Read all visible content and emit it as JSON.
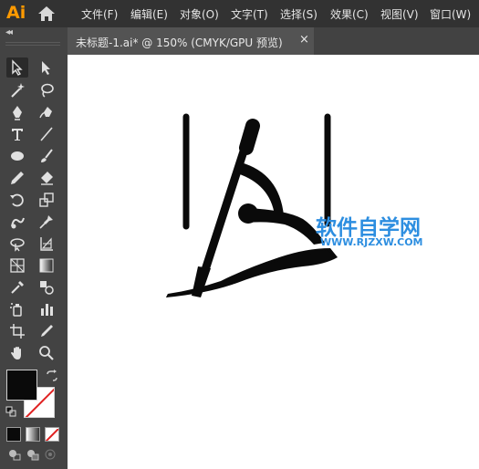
{
  "app": {
    "logo": "Ai"
  },
  "menu": {
    "items": [
      "文件(F)",
      "编辑(E)",
      "对象(O)",
      "文字(T)",
      "选择(S)",
      "效果(C)",
      "视图(V)",
      "窗口(W)"
    ]
  },
  "tools": {
    "collapse_glyph": "◂◂",
    "icons": [
      "selection-tool-icon",
      "direct-selection-tool-icon",
      "magic-wand-tool-icon",
      "lasso-tool-icon",
      "pen-tool-icon",
      "curvature-tool-icon",
      "type-tool-icon",
      "line-segment-tool-icon",
      "ellipse-tool-icon",
      "paintbrush-tool-icon",
      "pencil-tool-icon",
      "eraser-tool-icon",
      "rotate-tool-icon",
      "scale-tool-icon",
      "warp-tool-icon",
      "puppet-warp-tool-icon",
      "free-transform-tool-icon",
      "shape-builder-tool-icon",
      "perspective-grid-tool-icon",
      "gradient-tool-icon",
      "eyedropper-tool-icon",
      "blend-tool-icon",
      "symbol-sprayer-tool-icon",
      "column-graph-tool-icon",
      "artboard-tool-icon",
      "slice-tool-icon",
      "hand-tool-icon",
      "zoom-tool-icon"
    ]
  },
  "document": {
    "tab_title": "未标题-1.ai* @ 150% (CMYK/GPU 预览)",
    "close_glyph": "×"
  },
  "watermark": {
    "name": "软件自学网",
    "url": "WWW.RJZXW.COM"
  },
  "colors": {
    "fill": "#0a0a0a",
    "stroke": "none",
    "accent": "#2d8ee0",
    "logo": "#ff9a00"
  }
}
